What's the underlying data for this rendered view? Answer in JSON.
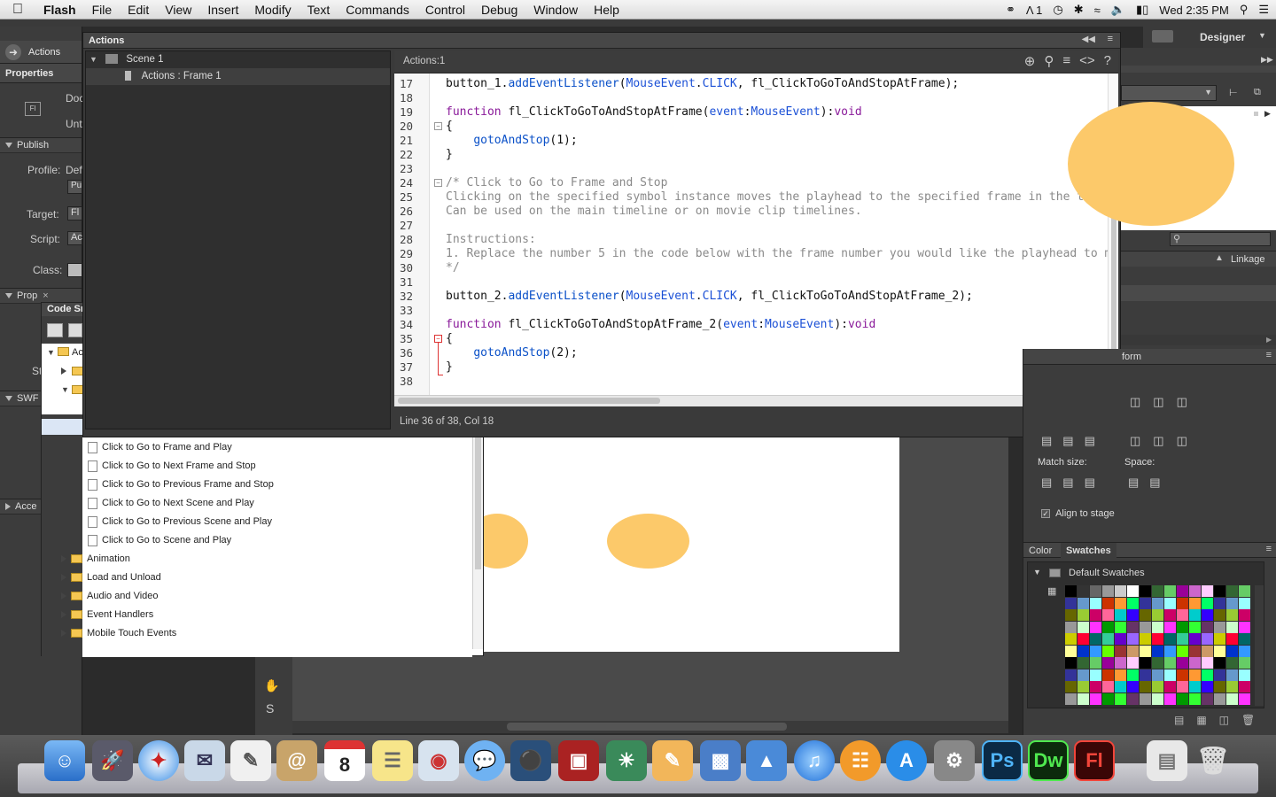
{
  "menubar": {
    "app": "Flash",
    "items": [
      "File",
      "Edit",
      "View",
      "Insert",
      "Modify",
      "Text",
      "Commands",
      "Control",
      "Debug",
      "Window",
      "Help"
    ],
    "ai_badge": "1",
    "clock": "Wed 2:35 PM"
  },
  "workspace": {
    "name": "Designer"
  },
  "left_panel": {
    "actions_tab": "Actions",
    "properties_tab": "Properties",
    "doc_label": "Doc",
    "untitled_label": "Unt",
    "fl_badge": "Fl",
    "publish_section": "Publish",
    "profile_label": "Profile:",
    "profile_value": "Def",
    "pub_button": "Pu",
    "target_label": "Target:",
    "target_value": "Fl",
    "script_label": "Script:",
    "script_value": "Ac",
    "class_label": "Class:",
    "prop_section": "Prop",
    "st_label": "St",
    "swf_section": "SWF",
    "acc_section": "Acce"
  },
  "actions_panel": {
    "title": "Actions",
    "tree": {
      "scene": "Scene 1",
      "frame": "Actions : Frame 1"
    },
    "editor_tab": "Actions:1",
    "status": "Line 36 of 38, Col 18",
    "lines": [
      {
        "n": "17",
        "t": "button_1.addEventListener(MouseEvent.CLICK, fl_ClickToGoToAndStopAtFrame);"
      },
      {
        "n": "18",
        "t": ""
      },
      {
        "n": "19",
        "t": "function fl_ClickToGoToAndStopAtFrame(event:MouseEvent):void"
      },
      {
        "n": "20",
        "t": "{"
      },
      {
        "n": "21",
        "t": "    gotoAndStop(1);"
      },
      {
        "n": "22",
        "t": "}"
      },
      {
        "n": "23",
        "t": ""
      },
      {
        "n": "24",
        "t": "/* Click to Go to Frame and Stop"
      },
      {
        "n": "25",
        "t": "Clicking on the specified symbol instance moves the playhead to the specified frame in the timel"
      },
      {
        "n": "26",
        "t": "Can be used on the main timeline or on movie clip timelines."
      },
      {
        "n": "27",
        "t": ""
      },
      {
        "n": "28",
        "t": "Instructions:"
      },
      {
        "n": "29",
        "t": "1. Replace the number 5 in the code below with the frame number you would like the playhead to m"
      },
      {
        "n": "30",
        "t": "*/"
      },
      {
        "n": "31",
        "t": ""
      },
      {
        "n": "32",
        "t": "button_2.addEventListener(MouseEvent.CLICK, fl_ClickToGoToAndStopAtFrame_2);"
      },
      {
        "n": "33",
        "t": ""
      },
      {
        "n": "34",
        "t": "function fl_ClickToGoToAndStopAtFrame_2(event:MouseEvent):void"
      },
      {
        "n": "35",
        "t": "{"
      },
      {
        "n": "36",
        "t": "    gotoAndStop(2);"
      },
      {
        "n": "37",
        "t": "}"
      },
      {
        "n": "38",
        "t": ""
      }
    ]
  },
  "code_snippets": {
    "title": "Code Sn",
    "root_folder": "Ac",
    "items": [
      "Click to Go to Frame and Play",
      "Click to Go to Next Frame and Stop",
      "Click to Go to Previous Frame and Stop",
      "Click to Go to Next Scene and Play",
      "Click to Go to Previous Scene and Play",
      "Click to Go to Scene and Play"
    ],
    "folders": [
      "Animation",
      "Load and Unload",
      "Audio and Video",
      "Event Handlers",
      "Mobile Touch Events"
    ]
  },
  "right_panel": {
    "linkage": "Linkage",
    "transform_tab": "form",
    "match_size": "Match size:",
    "space": "Space:",
    "align_to_stage": "Align to stage",
    "color_tab": "Color",
    "swatches_tab": "Swatches",
    "default_swatches": "Default Swatches"
  },
  "colors": {
    "shape_fill": "#fcc96a",
    "panel_bg": "#3c3c3c"
  },
  "dock": {
    "ps": "Ps",
    "dw": "Dw",
    "fl": "Fl",
    "calendar_day": "8"
  }
}
